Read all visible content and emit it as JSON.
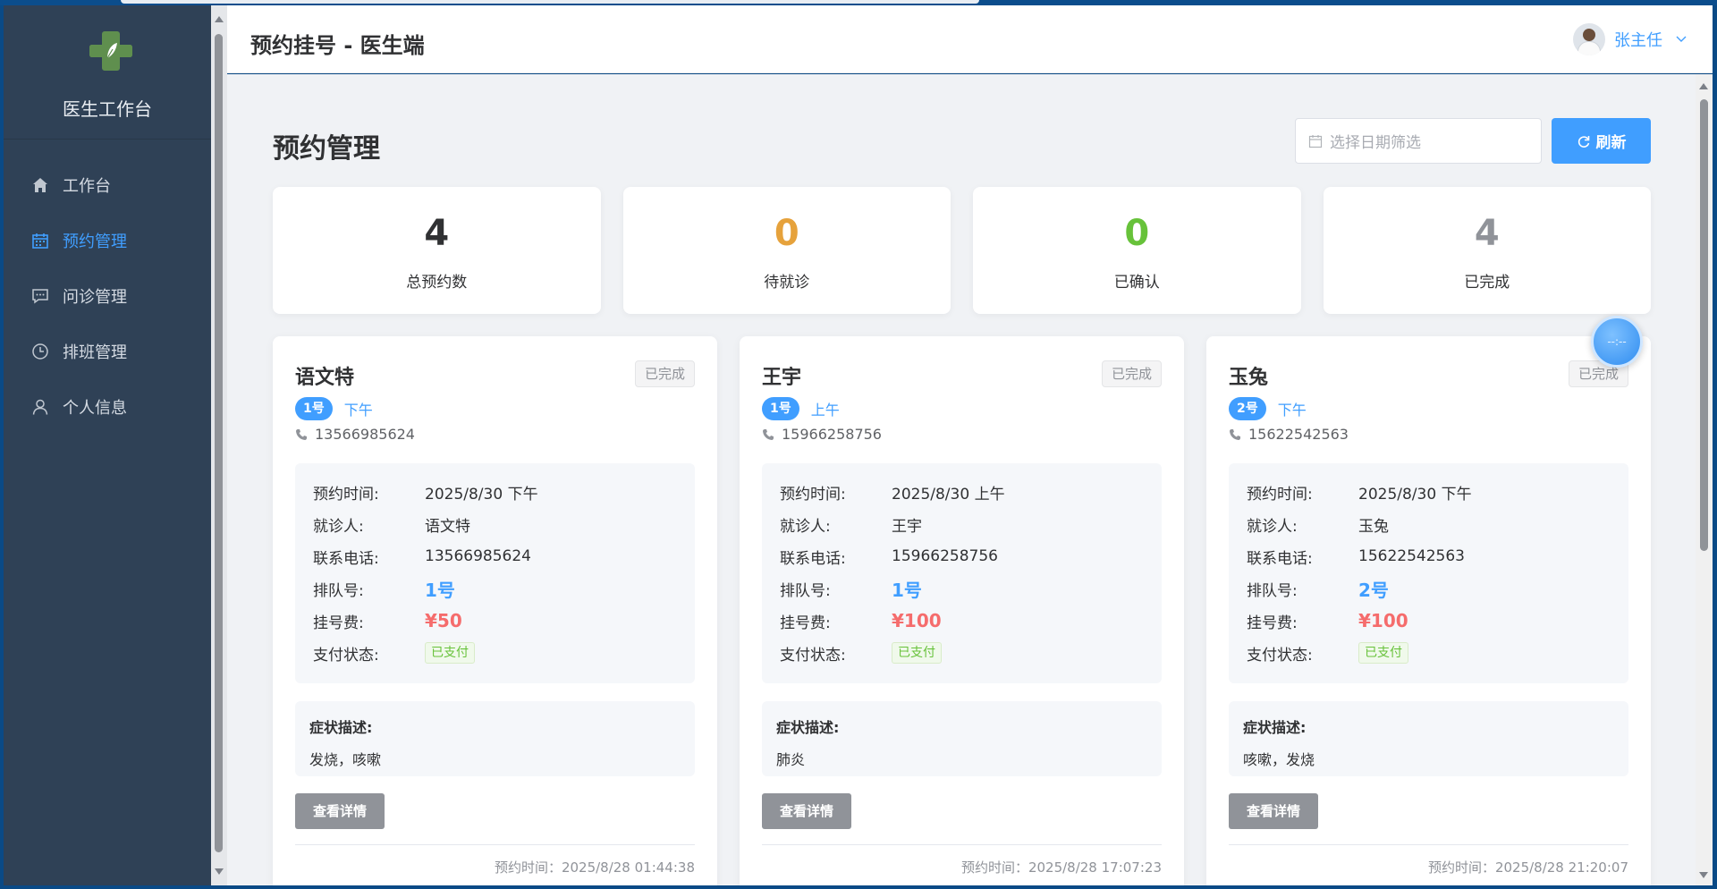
{
  "app": {
    "title": "医生工作台"
  },
  "sidebar": {
    "items": [
      {
        "label": "工作台",
        "icon": "home-icon",
        "active": false
      },
      {
        "label": "预约管理",
        "icon": "calendar-icon",
        "active": true
      },
      {
        "label": "问诊管理",
        "icon": "chat-icon",
        "active": false
      },
      {
        "label": "排班管理",
        "icon": "clock-icon",
        "active": false
      },
      {
        "label": "个人信息",
        "icon": "user-icon",
        "active": false
      }
    ]
  },
  "header": {
    "title": "预约挂号 - 医生端",
    "user_name": "张主任"
  },
  "page": {
    "title": "预约管理",
    "date_placeholder": "选择日期筛选",
    "refresh_label": "刷新"
  },
  "stats": [
    {
      "value": "4",
      "label": "总预约数",
      "color": "#303133"
    },
    {
      "value": "0",
      "label": "待就诊",
      "color": "#e6a23c"
    },
    {
      "value": "0",
      "label": "已确认",
      "color": "#67c23a"
    },
    {
      "value": "4",
      "label": "已完成",
      "color": "#909399"
    }
  ],
  "labels": {
    "time": "预约时间:",
    "patient": "就诊人:",
    "phone": "联系电话:",
    "queue": "排队号:",
    "fee": "挂号费:",
    "pay_status": "支付状态:",
    "symptom": "症状描述:",
    "detail_button": "查看详情"
  },
  "appointments": [
    {
      "name": "语文特",
      "status": "已完成",
      "queue_tag": "1号",
      "period": "下午",
      "phone": "13566985624",
      "time": "2025/8/30 下午",
      "patient": "语文特",
      "queue": "1号",
      "fee": "¥50",
      "pay_status": "已支付",
      "symptom": "发烧，咳嗽",
      "created": "预约时间：2025/8/28 01:44:38"
    },
    {
      "name": "王宇",
      "status": "已完成",
      "queue_tag": "1号",
      "period": "上午",
      "phone": "15966258756",
      "time": "2025/8/30 上午",
      "patient": "王宇",
      "queue": "1号",
      "fee": "¥100",
      "pay_status": "已支付",
      "symptom": "肺炎",
      "created": "预约时间：2025/8/28 17:07:23"
    },
    {
      "name": "玉兔",
      "status": "已完成",
      "queue_tag": "2号",
      "period": "下午",
      "phone": "15622542563",
      "time": "2025/8/30 下午",
      "patient": "玉兔",
      "queue": "2号",
      "fee": "¥100",
      "pay_status": "已支付",
      "symptom": "咳嗽，发烧",
      "created": "预约时间：2025/8/28 21:20:07"
    }
  ],
  "float_widget": {
    "text": "--:--"
  },
  "colors": {
    "accent": "#409eff",
    "sidebar_bg": "#2f4156",
    "logo_green": "#5f8f4e",
    "fee_red": "#f56c6c"
  }
}
